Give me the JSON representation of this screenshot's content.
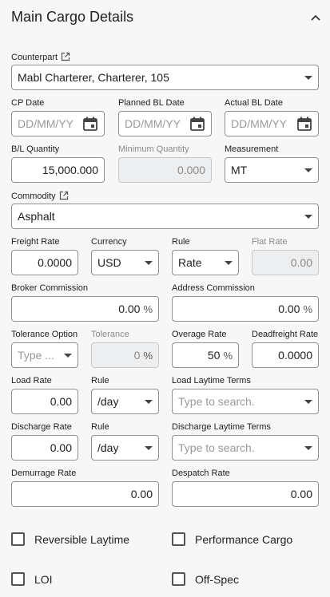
{
  "section": {
    "title": "Main Cargo Details"
  },
  "counterpart": {
    "label": "Counterpart",
    "value": "Mabl Charterer, Charterer, 105"
  },
  "cp_date": {
    "label": "CP Date",
    "placeholder": "DD/MM/YY"
  },
  "planned_bl_date": {
    "label": "Planned BL Date",
    "placeholder": "DD/MM/YY"
  },
  "actual_bl_date": {
    "label": "Actual BL Date",
    "placeholder": "DD/MM/YY"
  },
  "bl_quantity": {
    "label": "B/L Quantity",
    "value": "15,000.000"
  },
  "minimum_quantity": {
    "label": "Minimum Quantity",
    "value": "0.000"
  },
  "measurement": {
    "label": "Measurement",
    "value": "MT"
  },
  "commodity": {
    "label": "Commodity",
    "value": "Asphalt"
  },
  "freight_rate": {
    "label": "Freight Rate",
    "value": "0.0000"
  },
  "currency": {
    "label": "Currency",
    "value": "USD"
  },
  "rule": {
    "label": "Rule",
    "value": "Rate"
  },
  "flat_rate": {
    "label": "Flat Rate",
    "value": "0.00"
  },
  "broker_commission": {
    "label": "Broker Commission",
    "value": "0.00",
    "unit": "%"
  },
  "address_commission": {
    "label": "Address Commission",
    "value": "0.00",
    "unit": "%"
  },
  "tolerance_option": {
    "label": "Tolerance Option",
    "placeholder": "Type ..."
  },
  "tolerance": {
    "label": "Tolerance",
    "value": "0",
    "unit": "%"
  },
  "overage_rate": {
    "label": "Overage Rate",
    "value": "50",
    "unit": "%"
  },
  "deadfreight_rate": {
    "label": "Deadfreight Rate",
    "value": "0.0000"
  },
  "load_rate": {
    "label": "Load Rate",
    "value": "0.00"
  },
  "load_rule": {
    "label": "Rule",
    "value": "/day"
  },
  "load_laytime_terms": {
    "label": "Load Laytime Terms",
    "placeholder": "Type to search."
  },
  "discharge_rate": {
    "label": "Discharge Rate",
    "value": "0.00"
  },
  "discharge_rule": {
    "label": "Rule",
    "value": "/day"
  },
  "discharge_laytime_terms": {
    "label": "Discharge Laytime Terms",
    "placeholder": "Type to search."
  },
  "demurrage_rate": {
    "label": "Demurrage Rate",
    "value": "0.00"
  },
  "despatch_rate": {
    "label": "Despatch Rate",
    "value": "0.00"
  },
  "checkboxes": {
    "reversible_laytime": "Reversible Laytime",
    "performance_cargo": "Performance Cargo",
    "loi": "LOI",
    "off_spec": "Off-Spec"
  }
}
